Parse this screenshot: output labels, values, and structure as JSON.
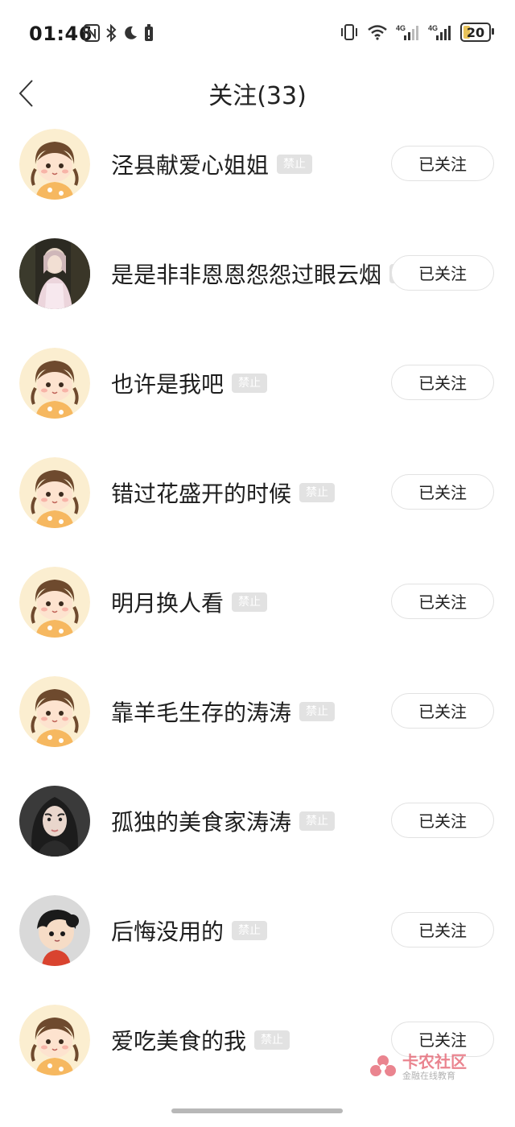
{
  "status_bar": {
    "time": "01:46",
    "battery_level": "20"
  },
  "header": {
    "title": "关注(33)"
  },
  "users": [
    {
      "name": "泾县献爱心姐姐",
      "badge": "禁止",
      "button": "已关注",
      "avatar": "cartoon-girl"
    },
    {
      "name": "是是非非恩恩怨怨过眼云烟",
      "badge": "禁止",
      "button": "已关注",
      "avatar": "photo-woman-forest"
    },
    {
      "name": "也许是我吧",
      "badge": "禁止",
      "button": "已关注",
      "avatar": "cartoon-girl"
    },
    {
      "name": "错过花盛开的时候",
      "badge": "禁止",
      "button": "已关注",
      "avatar": "cartoon-girl"
    },
    {
      "name": "明月换人看",
      "badge": "禁止",
      "button": "已关注",
      "avatar": "cartoon-girl"
    },
    {
      "name": "靠羊毛生存的涛涛",
      "badge": "禁止",
      "button": "已关注",
      "avatar": "cartoon-girl"
    },
    {
      "name": "孤独的美食家涛涛",
      "badge": "禁止",
      "button": "已关注",
      "avatar": "photo-woman-portrait"
    },
    {
      "name": "后悔没用的",
      "badge": "禁止",
      "button": "已关注",
      "avatar": "cartoon-kid"
    },
    {
      "name": "爱吃美食的我",
      "badge": "禁止",
      "button": "已关注",
      "avatar": "cartoon-girl"
    }
  ],
  "watermark": {
    "main": "卡农社区",
    "sub": "金融在线教育"
  },
  "colors": {
    "badge_bg": "#e2e2e2",
    "button_border": "#e2e2e2",
    "watermark_red": "#e35b6a",
    "battery_fill": "#e8c35a"
  }
}
